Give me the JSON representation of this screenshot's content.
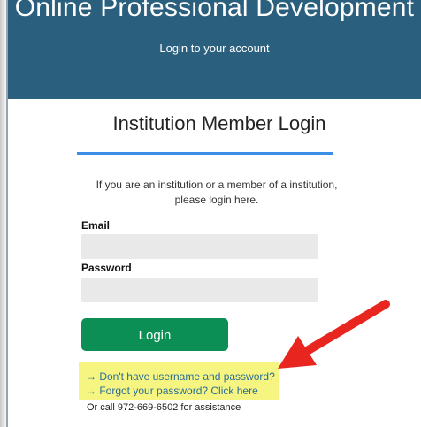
{
  "header": {
    "site_title": "Online Professional Development",
    "subtitle": "Login to your account",
    "background_color": "#2b5f7e"
  },
  "login_form": {
    "heading": "Institution Member Login",
    "intro_text": "If you are an institution or a member of a institution, please login here.",
    "email_label": "Email",
    "email_value": "",
    "password_label": "Password",
    "password_value": "",
    "login_button_label": "Login",
    "login_button_color": "#0c8f55",
    "accent_rule_color": "#3b8ee6"
  },
  "links": {
    "no_account": "→ Don't have username and password?",
    "forgot_password": "→ Forgot your password? Click here",
    "assistance": "Or call 972-669-6502 for assistance",
    "link_color": "#2a6e97"
  },
  "annotation": {
    "highlight_color": "#f6f581",
    "arrow_color": "#e8251f",
    "arrow_icon": "red-arrow-icon"
  }
}
